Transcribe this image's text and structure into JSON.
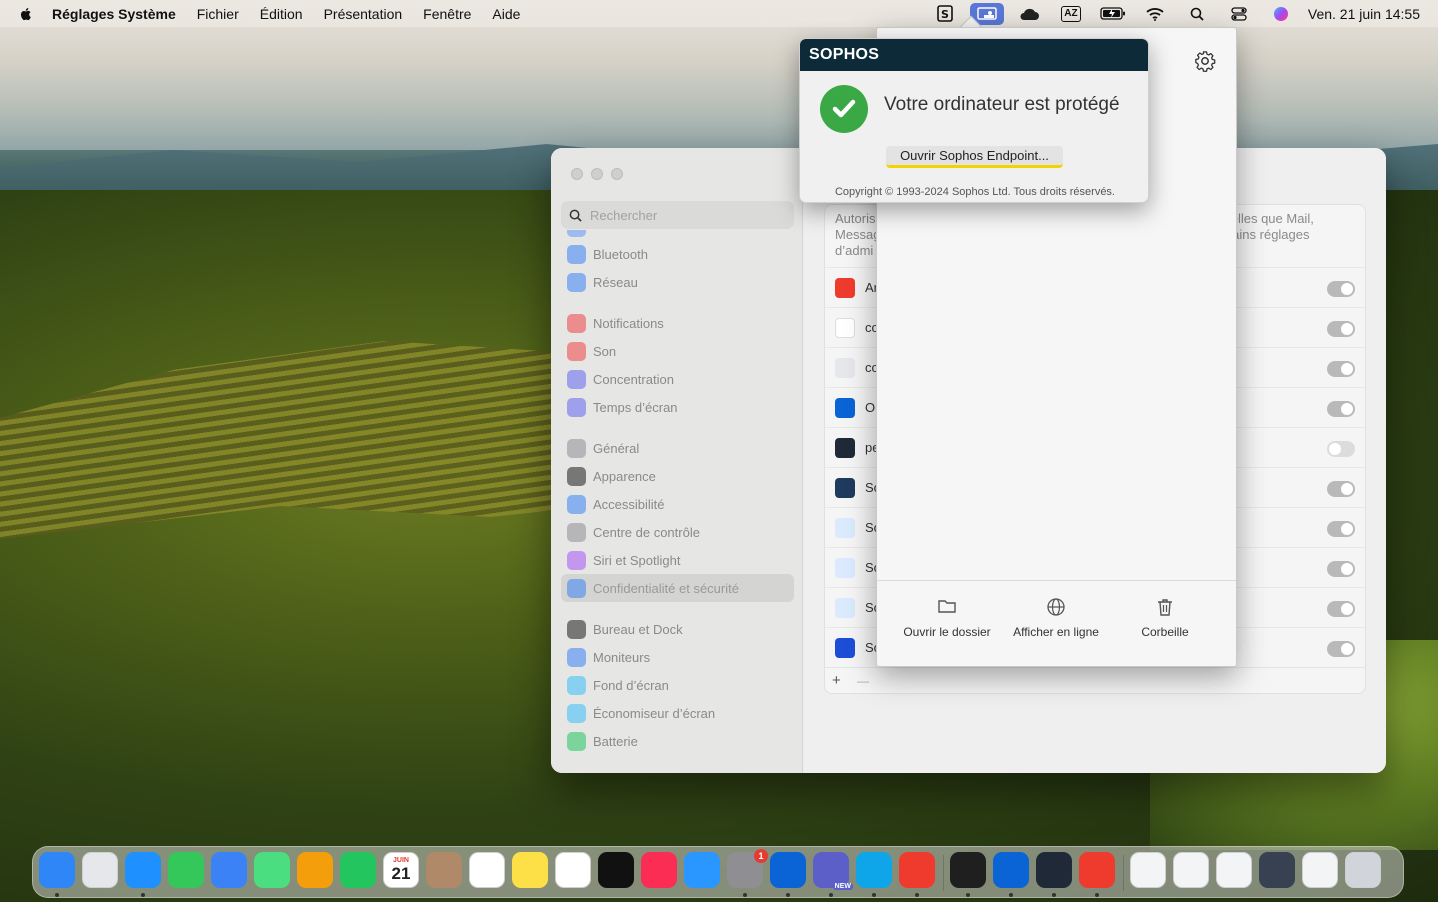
{
  "menubar": {
    "app_name": "Réglages Système",
    "menus": [
      "Fichier",
      "Édition",
      "Présentation",
      "Fenêtre",
      "Aide"
    ],
    "clock": "Ven. 21 juin  14:55",
    "status_icons": [
      "sophos-icon",
      "screen-share-icon",
      "cloud-icon",
      "keyboard-input-icon",
      "battery-icon",
      "wifi-icon",
      "search-icon",
      "control-center-icon",
      "siri-icon"
    ],
    "input_label": "AZ"
  },
  "sophos": {
    "brand": "SOPHOS",
    "status": "Votre ordinateur est protégé",
    "open_button": "Ouvrir Sophos Endpoint...",
    "copyright": "Copyright © 1993-2024 Sophos Ltd. Tous droits réservés."
  },
  "popover": {
    "actions": [
      {
        "label": "Ouvrir le dossier",
        "icon": "folder-icon"
      },
      {
        "label": "Afficher en ligne",
        "icon": "globe-icon"
      },
      {
        "label": "Corbeille",
        "icon": "trash-icon"
      }
    ]
  },
  "settings": {
    "search_placeholder": "Rechercher",
    "sidebar": [
      {
        "label": "Bluetooth",
        "icon": "bluetooth-icon",
        "color": "#3b82f6"
      },
      {
        "label": "Réseau",
        "icon": "network-icon",
        "color": "#3b82f6"
      },
      {
        "label": "Notifications",
        "icon": "notifications-icon",
        "color": "#ef4444"
      },
      {
        "label": "Son",
        "icon": "sound-icon",
        "color": "#ef4444"
      },
      {
        "label": "Concentration",
        "icon": "moon-icon",
        "color": "#6366f1"
      },
      {
        "label": "Temps d’écran",
        "icon": "hourglass-icon",
        "color": "#6366f1"
      },
      {
        "label": "Général",
        "icon": "gear-icon",
        "color": "#8e8e93"
      },
      {
        "label": "Apparence",
        "icon": "appearance-icon",
        "color": "#1c1c1e"
      },
      {
        "label": "Accessibilité",
        "icon": "accessibility-icon",
        "color": "#3b82f6"
      },
      {
        "label": "Centre de contrôle",
        "icon": "control-center-icon",
        "color": "#8e8e93"
      },
      {
        "label": "Siri et Spotlight",
        "icon": "siri-icon",
        "color": "#a855f7"
      },
      {
        "label": "Confidentialité et sécurité",
        "icon": "hand-icon",
        "color": "#3b82f6"
      },
      {
        "label": "Bureau et Dock",
        "icon": "dock-icon",
        "color": "#1c1c1e"
      },
      {
        "label": "Moniteurs",
        "icon": "display-icon",
        "color": "#3b82f6"
      },
      {
        "label": "Fond d’écran",
        "icon": "wallpaper-icon",
        "color": "#38bdf8"
      },
      {
        "label": "Économiseur d’écran",
        "icon": "screensaver-icon",
        "color": "#38bdf8"
      },
      {
        "label": "Batterie",
        "icon": "battery-icon",
        "color": "#22c55e"
      }
    ],
    "description_left": "Autoris Messag d’admi",
    "description_right": "s telles que Mail, ertains réglages",
    "apps": [
      {
        "name": "Ar",
        "icon": "anydesk-icon",
        "color": "#ef3b2d",
        "enabled": true
      },
      {
        "name": "co",
        "icon": "document-icon",
        "color": "#ffffff",
        "enabled": true
      },
      {
        "name": "co",
        "icon": "shield-icon",
        "color": "#e5e7eb",
        "enabled": true
      },
      {
        "name": "Or",
        "icon": "onedrive-icon",
        "color": "#0a64d6",
        "enabled": true
      },
      {
        "name": "pe",
        "icon": "terminal-icon",
        "color": "#1f2937",
        "enabled": false
      },
      {
        "name": "Sc",
        "icon": "sophos-ring-icon",
        "color": "#1e3a5f",
        "enabled": true
      },
      {
        "name": "Sc",
        "icon": "generic-app-icon",
        "color": "#dbeafe",
        "enabled": true
      },
      {
        "name": "Sc",
        "icon": "generic-app-icon",
        "color": "#dbeafe",
        "enabled": true
      },
      {
        "name": "Sc",
        "icon": "generic-app-icon",
        "color": "#dbeafe",
        "enabled": true
      },
      {
        "name": "Sc",
        "icon": "sophos-s-icon",
        "color": "#1d4ed8",
        "enabled": true
      }
    ],
    "add_label": "+",
    "remove_label": "—"
  },
  "dock": {
    "apps": [
      {
        "name": "finder-icon",
        "color": "#2f86f6",
        "running": true
      },
      {
        "name": "launchpad-icon",
        "color": "#e5e7eb",
        "running": false
      },
      {
        "name": "safari-icon",
        "color": "#1e90ff",
        "running": true
      },
      {
        "name": "messages-icon",
        "color": "#34c759",
        "running": false
      },
      {
        "name": "mail-icon",
        "color": "#3b82f6",
        "running": false
      },
      {
        "name": "maps-icon",
        "color": "#4ade80",
        "running": false
      },
      {
        "name": "photos-icon",
        "color": "#f59e0b",
        "running": false
      },
      {
        "name": "facetime-icon",
        "color": "#22c55e",
        "running": false
      },
      {
        "name": "calendar-icon",
        "color": "#ffffff",
        "running": false
      },
      {
        "name": "contacts-icon",
        "color": "#b08968",
        "running": false
      },
      {
        "name": "reminders-icon",
        "color": "#ffffff",
        "running": false
      },
      {
        "name": "notes-icon",
        "color": "#fde047",
        "running": false
      },
      {
        "name": "freeform-icon",
        "color": "#ffffff",
        "running": false
      },
      {
        "name": "apple-tv-icon",
        "color": "#111111",
        "running": false
      },
      {
        "name": "music-icon",
        "color": "#fb2d55",
        "running": false
      },
      {
        "name": "app-store-icon",
        "color": "#2997ff",
        "running": false
      },
      {
        "name": "system-settings-icon",
        "color": "#8e8e93",
        "running": true
      },
      {
        "name": "outlook-icon",
        "color": "#0a64d6",
        "running": true
      },
      {
        "name": "teams-icon",
        "color": "#5b5fc7",
        "running": true
      },
      {
        "name": "edge-icon",
        "color": "#0ea5e9",
        "running": true
      },
      {
        "name": "anydesk-icon",
        "color": "#ef3b2d",
        "running": true
      },
      {
        "name": "terminal-icon",
        "color": "#1f1f1f",
        "running": true
      },
      {
        "name": "remote-desktop-icon",
        "color": "#0a64d6",
        "running": true
      },
      {
        "name": "activity-monitor-icon",
        "color": "#1f2937",
        "running": true
      },
      {
        "name": "anydesk-user-icon",
        "color": "#ef3b2d",
        "running": true
      },
      {
        "name": "minimized-window-1-icon",
        "color": "#f3f4f6",
        "running": false
      },
      {
        "name": "minimized-window-2-icon",
        "color": "#f3f4f6",
        "running": false
      },
      {
        "name": "minimized-window-3-icon",
        "color": "#f3f4f6",
        "running": false
      },
      {
        "name": "minimized-window-4-icon",
        "color": "#374151",
        "running": false
      },
      {
        "name": "minimized-window-5-icon",
        "color": "#f3f4f6",
        "running": false
      },
      {
        "name": "trash-icon",
        "color": "#d1d5db",
        "running": false
      }
    ],
    "calendar_month": "JUIN",
    "calendar_day": "21",
    "settings_badge": "1",
    "teams_badge": "NEW"
  }
}
